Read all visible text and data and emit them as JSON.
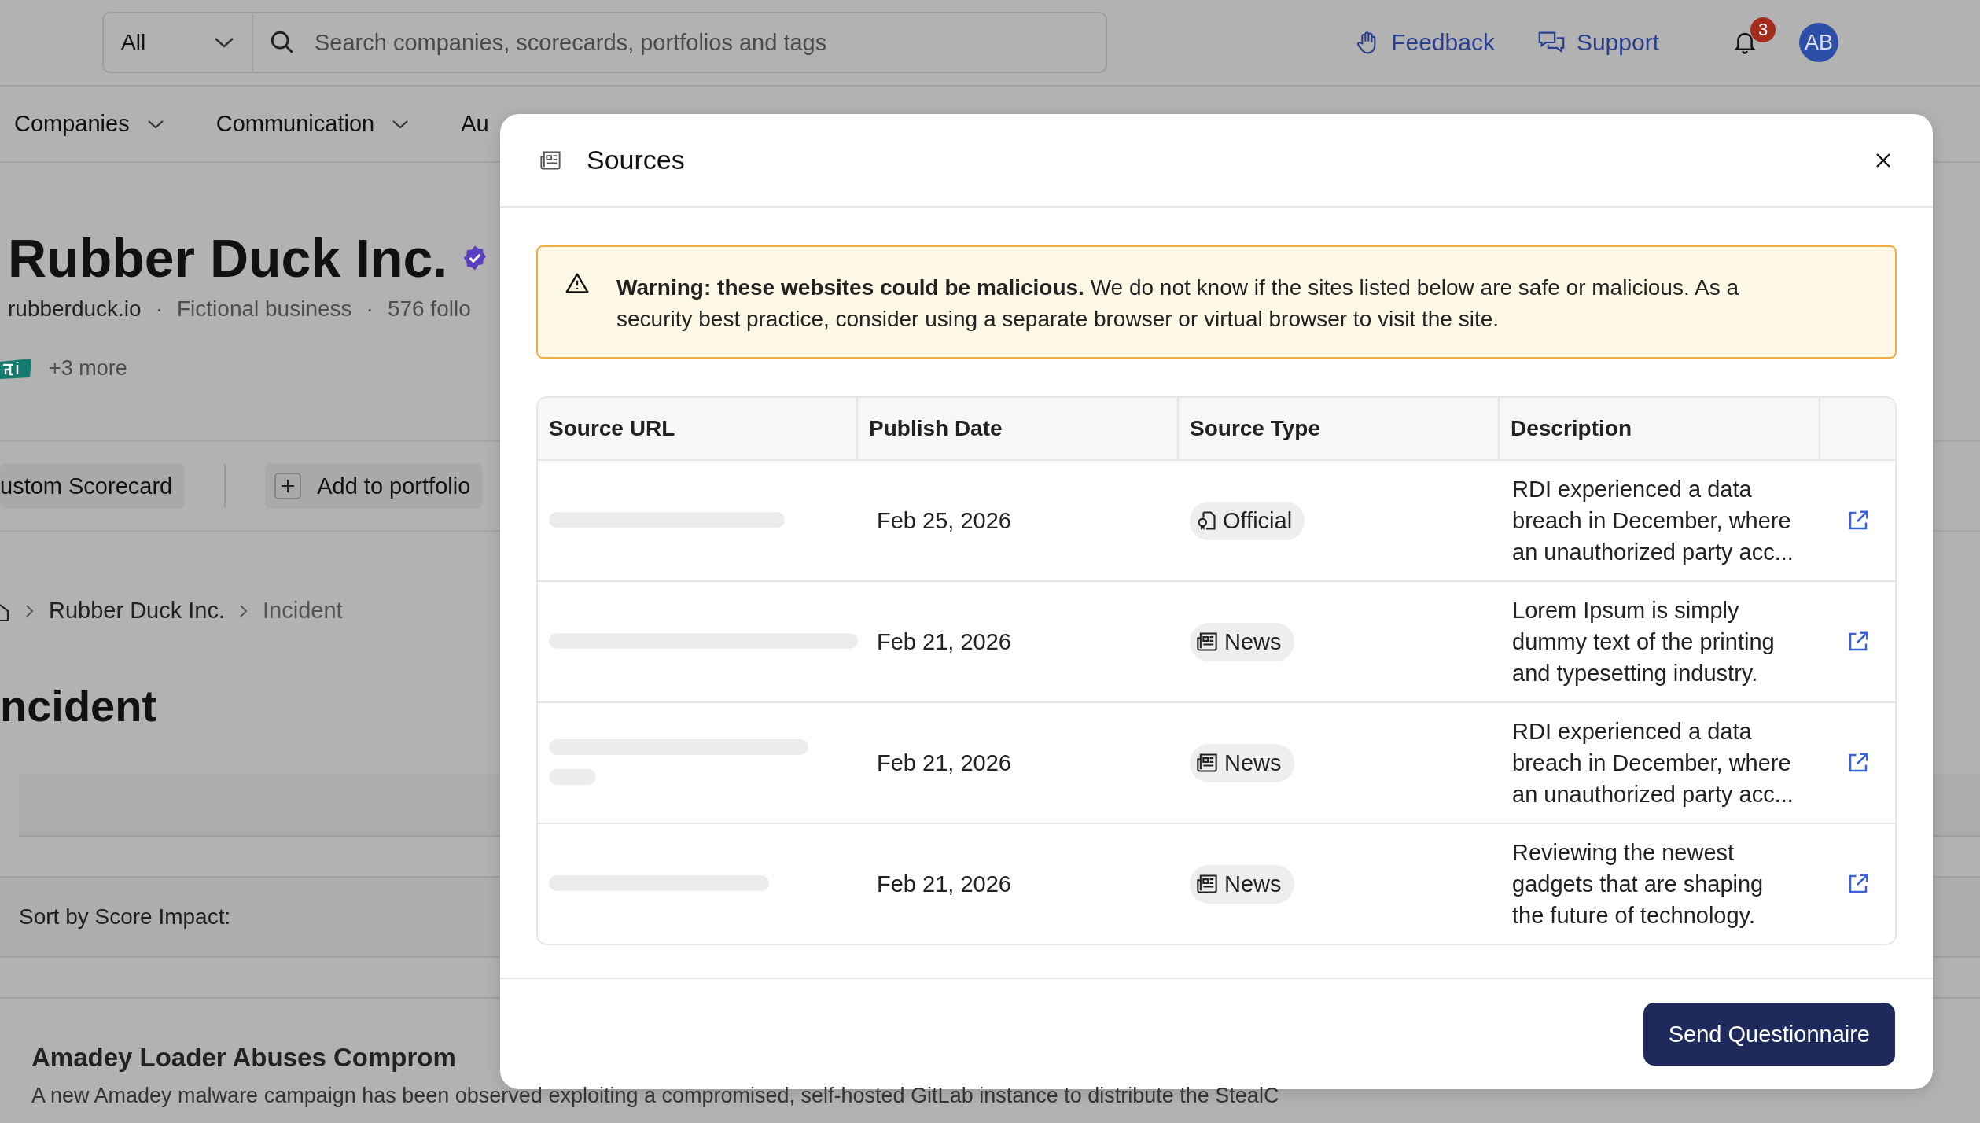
{
  "top_bar": {
    "scope_select": {
      "value": "All"
    },
    "search": {
      "placeholder": "Search companies, scorecards, portfolios and tags"
    },
    "links": [
      {
        "label": "Feedback",
        "kind": "feedback"
      },
      {
        "label": "Support",
        "kind": "support"
      }
    ],
    "notifications": {
      "count": "3"
    },
    "avatar": {
      "initials": "AB"
    }
  },
  "nav": [
    {
      "label": "Companies"
    },
    {
      "label": "Communication"
    },
    {
      "label": "Au"
    }
  ],
  "company": {
    "name": "Rubber Duck Inc.",
    "verified": true,
    "meta": [
      "rubberduck.io",
      "Fictional business",
      "576 follo"
    ],
    "separator": "·",
    "badge_more": "+3 more"
  },
  "actions": [
    {
      "label": "ustom Scorecard",
      "kind": "plain"
    },
    {
      "label": "Add to portfolio",
      "kind": "add"
    }
  ],
  "breadcrumb": [
    "Rubber Duck Inc.",
    "Incident"
  ],
  "page_title": "ncident",
  "sort_label": "Sort by Score Impact:",
  "article": {
    "title": "Amadey Loader Abuses Comprom",
    "text": "A new Amadey malware campaign has been observed exploiting a compromised, self-hosted GitLab instance to distribute the StealC"
  },
  "modal": {
    "title": "Sources",
    "warning": "**Warning: these websites could be malicious.** We do not know if the sites listed below are safe or malicious. As a security best practice, consider using a separate browser or virtual browser to visit the site.",
    "columns": [
      "Source URL",
      "Publish Date",
      "Source Type",
      "Description"
    ],
    "rows": [
      {
        "date": "Feb 25, 2026",
        "type": {
          "label": "Official",
          "kind": "official"
        },
        "description": "RDI experienced a data breach in December, where an unauthorized party acc..."
      },
      {
        "date": "Feb 21, 2026",
        "type": {
          "label": "News",
          "kind": "news"
        },
        "description": "Lorem Ipsum is simply dummy text of the printing and typesetting industry."
      },
      {
        "date": "Feb 21, 2026",
        "type": {
          "label": "News",
          "kind": "news"
        },
        "description": "RDI experienced a data breach in December, where an unauthorized party acc..."
      },
      {
        "date": "Feb 21, 2026",
        "type": {
          "label": "News",
          "kind": "news"
        },
        "description": "Reviewing the newest gadgets that are shaping the future of technology."
      }
    ],
    "primary_button": "Send Questionnaire"
  }
}
